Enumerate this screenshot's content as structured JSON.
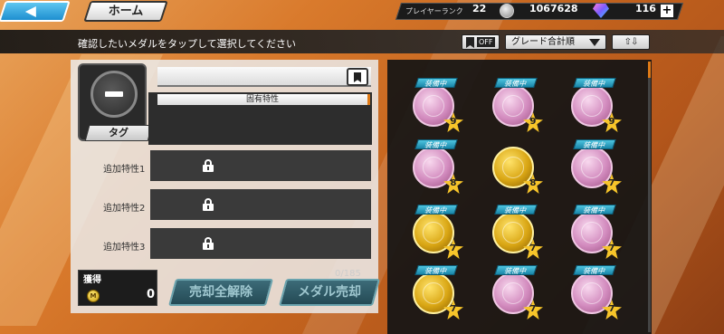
{
  "header": {
    "home_label": "ホーム",
    "player_rank_label": "プレイヤーランク",
    "player_rank_value": "22",
    "coins": "1067628",
    "gems": "116",
    "plus_label": "+"
  },
  "toolbar": {
    "instruction": "確認したいメダルをタップして選択してください",
    "bookmark_filter_state": "OFF",
    "sort_select_value": "グレード合計順",
    "sort_order_label": "⇧⇩"
  },
  "detail": {
    "tag_label": "タグ",
    "inherent_trait_label": "固有特性",
    "extra_traits": [
      {
        "label": "追加特性1"
      },
      {
        "label": "追加特性2"
      },
      {
        "label": "追加特性3"
      }
    ]
  },
  "footer": {
    "acquire_label": "獲得",
    "acquire_coin_letter": "M",
    "acquire_value": "0",
    "count": "0/185",
    "unsell_all_label": "売却全解除",
    "sell_label": "メダル売却"
  },
  "medals": [
    {
      "color": "pink",
      "equipped_label": "装備中",
      "grade": "9"
    },
    {
      "color": "pink",
      "equipped_label": "装備中",
      "grade": "9"
    },
    {
      "color": "pink",
      "equipped_label": "装備中",
      "grade": "9"
    },
    {
      "color": "pink",
      "equipped_label": "装備中",
      "grade": "8"
    },
    {
      "color": "gold",
      "equipped_label": "",
      "grade": "8"
    },
    {
      "color": "pink",
      "equipped_label": "装備中",
      "grade": "7"
    },
    {
      "color": "gold",
      "equipped_label": "装備中",
      "grade": "7"
    },
    {
      "color": "gold",
      "equipped_label": "装備中",
      "grade": "7"
    },
    {
      "color": "pink",
      "equipped_label": "装備中",
      "grade": "7"
    },
    {
      "color": "gold",
      "equipped_label": "装備中",
      "grade": "7"
    },
    {
      "color": "pink",
      "equipped_label": "装備中",
      "grade": "7"
    },
    {
      "color": "pink",
      "equipped_label": "装備中",
      "grade": "7"
    }
  ],
  "colors": {
    "accent_orange": "#e07a16",
    "badge_blue": "#1985a8",
    "button_teal": "#3c6b78"
  }
}
